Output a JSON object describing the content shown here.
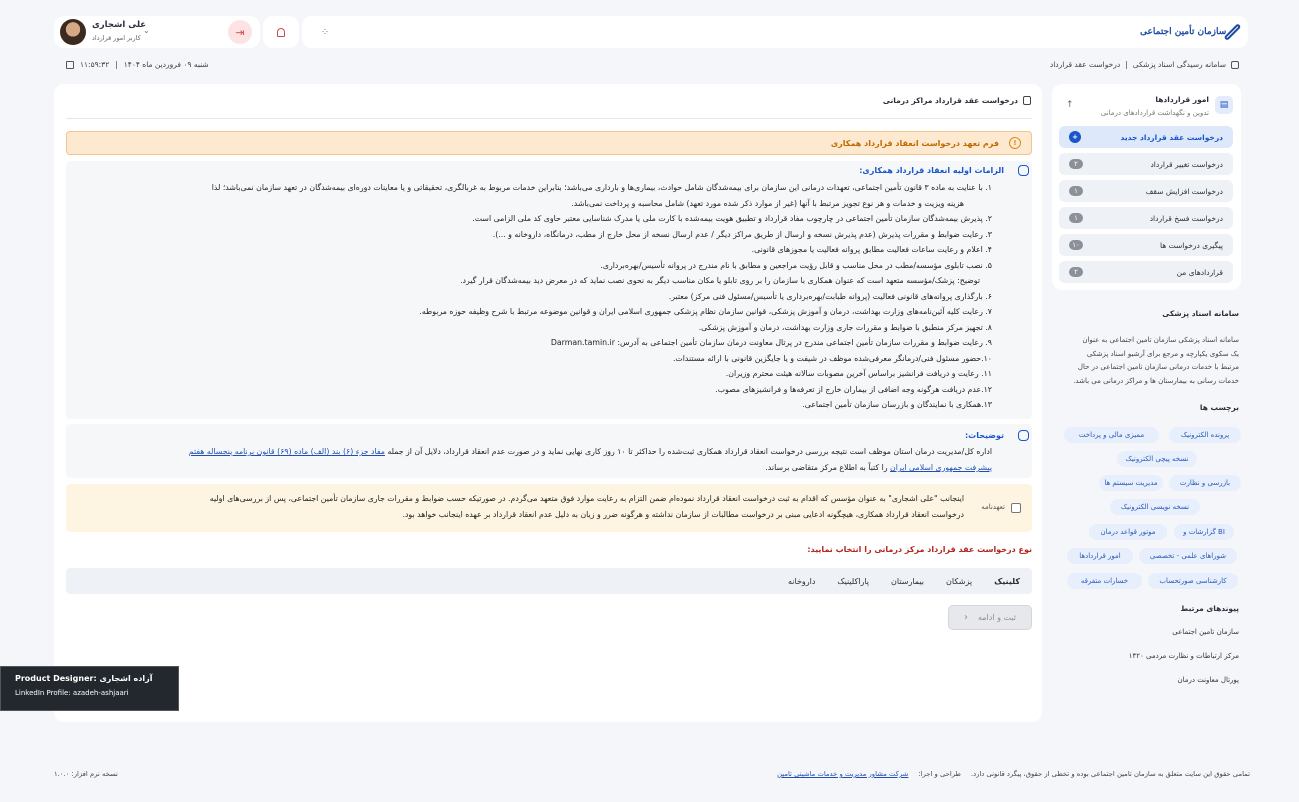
{
  "header": {
    "logo_text": "سازمان تأمین اجتماعی",
    "user_name": "علی اشجاری",
    "user_role": "کاربر امور قرارداد"
  },
  "breadcrumb": {
    "root": "سامانه رسیدگی اسناد پزشکی",
    "sep": "|",
    "current": "درخواست عقد قرارداد"
  },
  "datetime": {
    "date": "شنبه ۰۹ فروردین ماه ۱۴۰۴",
    "sep": "|",
    "time": "۱۱:۵۹:۳۲"
  },
  "sidebar": {
    "title": "امور قراردادها",
    "subtitle": "تدوین و نگهداشت قراردادهای درمانی",
    "items": [
      {
        "label": "درخواست عقد قرارداد جدید",
        "badge": "+"
      },
      {
        "label": "درخواست تغییر قرارداد",
        "badge": "۲"
      },
      {
        "label": "درخواست افزایش سقف",
        "badge": "۱"
      },
      {
        "label": "درخواست فسخ قرارداد",
        "badge": "۱"
      },
      {
        "label": "پیگیری درخواست ها",
        "badge": "۱۰"
      },
      {
        "label": "قراردادهای من",
        "badge": "۲"
      }
    ]
  },
  "about": {
    "title": "سامانه اسناد پزشکی",
    "lines": [
      "سامانه اسناد پزشکی سازمان تامین اجتماعی به عنوان",
      "یک سکوی یکپارچه و مرجع برای آرشیو اسناد پزشکی",
      "مرتبط با خدمات درمانی سازمان تامین اجتماعی در حال",
      "خدمات رسانی به بیمارستان ها و مراکز درمانی می باشد."
    ]
  },
  "tags_title": "برچسب ها",
  "tags": [
    "پرونده الکترونیک",
    "ممیزی مالی و پرداخت",
    "نسخه پیچی الکترونیک",
    "بازرسی و نظارت",
    "مدیریت سیستم ها",
    "نسخه نویسی الکترونیک",
    "گزارشات و BI",
    "موتور قواعد درمان",
    "شوراهای علمی - تخصصی",
    "امور قراردادها",
    "کارشناسی صورتحساب",
    "خسارات متفرقه"
  ],
  "links": {
    "title": "پیوندهای مرتبط",
    "items": [
      "سازمان تامین اجتماعی",
      "مرکز ارتباطات و نظارت مردمی ۱۴۲۰",
      "پورتال معاونت درمان"
    ]
  },
  "main": {
    "title": "درخواست عقد قرارداد مراکز درمانی",
    "alert": "فرم تعهد درخواست انعقاد قرارداد همکاری",
    "rules_title": "الزامات اولیه انعقاد قرارداد همکاری:",
    "rules": [
      "۱. با عنایت به ماده ۳ قانون تأمین اجتماعی، تعهدات درمانی این سازمان برای بیمه‌شدگان شامل حوادث، بیماری‌ها و بارداری می‌باشد؛ بنابراین خدمات مربوط به غربالگری، تحقیقاتی و یا معاینات دوره‌ای بیمه‌شدگان در تعهد سازمان نمی‌باشد؛ لذا",
      "هزینه ویزیت و خدمات و هر نوع تجویز مرتبط با آنها (غیر از موارد ذکر شده مورد تعهد) شامل محاسبه و پرداخت نمی‌باشد.",
      "۲. پذیرش بیمه‌شدگان سازمان تأمین اجتماعی در چارچوب مفاد قرارداد و تطبیق هویت بیمه‌شده با کارت ملی یا مدرک شناسایی معتبر حاوی کد ملی الزامی است.",
      "۳. رعایت ضوابط و مقررات پذیرش (عدم پذیرش نسخه و ارسال از طریق مراکز دیگر / عدم ارسال نسخه از محل خارج از مطب، درمانگاه، داروخانه و ...).",
      "۴. اعلام و رعایت ساعات فعالیت مطابق پروانه فعالیت یا مجوزهای قانونی.",
      "۵. نصب تابلوی مؤسسه/مطب در محل مناسب و قابل رؤیت مراجعین و مطابق با نام مندرج در پروانه تأسیس/بهره‌برداری.",
      "توضیح: پزشک/مؤسسه متعهد است که عنوان همکاری با سازمان را بر روی تابلو یا مکان مناسب دیگر به نحوی نصب نماید که در معرض دید بیمه‌شدگان قرار گیرد.",
      "۶. بارگذاری پروانه‌های قانونی فعالیت (پروانه طبابت/بهره‌برداری یا تأسیس/مسئول فنی مرکز) معتبر.",
      "۷. رعایت کلیه آئین‌نامه‌های وزارت بهداشت، درمان و آموزش پزشکی، قوانین سازمان نظام پزشکی جمهوری اسلامی ایران و قوانین موضوعه مرتبط با شرح وظیفه حوزه مربوطه.",
      "۸. تجهیز مرکز منطبق با ضوابط و مقررات جاری وزارت بهداشت، درمان و آموزش پزشکی.",
      "۹. رعایت ضوابط و مقررات سازمان تأمین اجتماعی مندرج در پرتال معاونت درمان سازمان تأمین اجتماعی به آدرس: Darman.tamin.ir",
      "۱۰.حضور مسئول فنی/درمانگر معرفی‌شده موظف در شیفت و یا جایگزین قانونی با ارائه مستندات.",
      "۱۱. رعایت و دریافت فرانشیز براساس آخرین مصوبات سالانه هیئت محترم وزیران.",
      "۱۲.عدم دریافت هرگونه وجه اضافی از بیماران خارج از تعرفه‌ها و فرانشیزهای مصوب.",
      "۱۳.همکاری با نمایندگان و بازرسان سازمان تأمین اجتماعی."
    ],
    "notes_title": "توضیحات:",
    "notes_l1a": "اداره کل/مدیریت درمان استان موظف است نتیجه بررسی درخواست انعقاد قرارداد همکاری ثبت‌شده را حداکثر تا ۱۰ روز کاری نهایی نماید و در صورت عدم انعقاد قرارداد، دلایل آن از جمله ",
    "notes_link1": "مفاد جزء (۶) بند (الف) ماده (۶۹) قانون برنامه پنجساله هفتم",
    "notes_link2": "پیشرفت جمهوری اسلامی ایران",
    "notes_l2b": " را کتباً به اطلاع مرکز متقاضی برساند.",
    "commit_label": "تعهدنامه",
    "commit_lines": [
      "اینجانب \"علی اشجاری\" به عنوان مؤسس که اقدام به ثبت درخواست انعقاد قرارداد نموده‌ام ضمن التزام به رعایت موارد فوق متعهد می‌گردم. در صورتیکه حسب ضوابط و مقررات جاری سازمان تأمین اجتماعی، پس از بررسی‌های اولیه",
      "درخواست انعقاد قرارداد همکاری، هیچگونه ادعایی مبنی بر درخواست مطالبات از سازمان نداشته و هرگونه ضرر و زیان به دلیل عدم انعقاد قرارداد بر عهده اینجانب خواهد بود."
    ],
    "type_title": "نوع درخواست عقد قرارداد مرکز درمانی را انتخاب نمایید:",
    "types": [
      "کلینیک",
      "پزشکان",
      "بیمارستان",
      "پاراکلینیک",
      "داروخانه"
    ],
    "submit": "ثبت و ادامه"
  },
  "footer": {
    "copyright": "تمامی حقوق این سایت متعلق به سازمان تامین اجتماعی بوده و تخطی از حقوق، پیگرد قانونی دارد.",
    "design_prefix": "طراحی و اجرا:",
    "design_link": "شرکت مشاور مدیریت و خدمات ماشینی تامین",
    "version": "نسخه نرم افزار: ۱.۰.۰"
  },
  "credit": {
    "line1": "Product Designer: آزاده اشجاری",
    "line2": "LinkedIn Profile:  azadeh-ashjaari"
  },
  "colors": {
    "primary": "#1a56c9",
    "alert_bg": "#fde9cf",
    "warn": "#d98a18",
    "danger": "#c0392b"
  }
}
